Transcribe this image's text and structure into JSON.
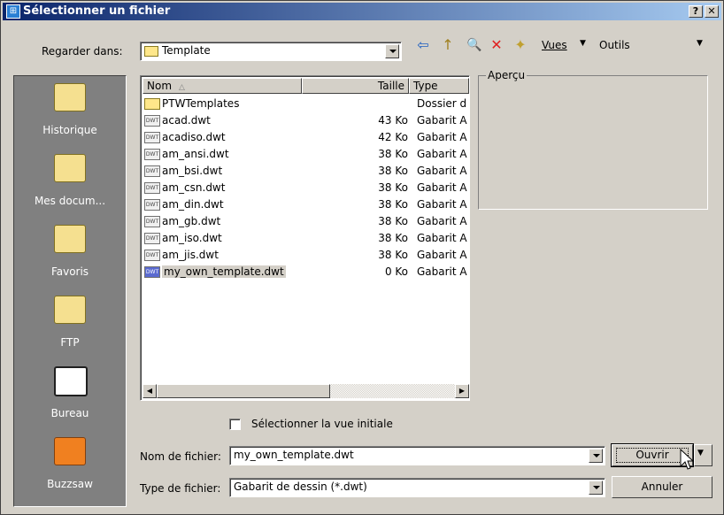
{
  "window": {
    "title": "Sélectionner un fichier",
    "help_label": "?",
    "close_label": "✕",
    "app_icon": "dialog-icon"
  },
  "toolbar": {
    "look_in_label": "Regarder dans:",
    "look_in_value": "Template",
    "back_glyph": "⇦",
    "up_glyph": "↑",
    "search_glyph": "🔍",
    "delete_glyph": "✕",
    "newfolder_glyph": "✦",
    "views_label": "Vues",
    "tools_label": "Outils"
  },
  "places": [
    {
      "label": "Historique",
      "icon": "history-icon"
    },
    {
      "label": "Mes docum...",
      "icon": "my-documents-icon"
    },
    {
      "label": "Favoris",
      "icon": "favorites-icon"
    },
    {
      "label": "FTP",
      "icon": "ftp-icon"
    },
    {
      "label": "Bureau",
      "icon": "desktop-icon"
    },
    {
      "label": "Buzzsaw",
      "icon": "buzzsaw-icon"
    }
  ],
  "columns": {
    "name": "Nom",
    "name_sort": "△",
    "size": "Taille",
    "type": "Type"
  },
  "dwt_badge": "DWT",
  "files": [
    {
      "name": "PTWTemplates",
      "size": "",
      "type": "Dossier d",
      "kind": "folder"
    },
    {
      "name": "acad.dwt",
      "size": "43 Ko",
      "type": "Gabarit A",
      "kind": "dwt"
    },
    {
      "name": "acadiso.dwt",
      "size": "42 Ko",
      "type": "Gabarit A",
      "kind": "dwt"
    },
    {
      "name": "am_ansi.dwt",
      "size": "38 Ko",
      "type": "Gabarit A",
      "kind": "dwt"
    },
    {
      "name": "am_bsi.dwt",
      "size": "38 Ko",
      "type": "Gabarit A",
      "kind": "dwt"
    },
    {
      "name": "am_csn.dwt",
      "size": "38 Ko",
      "type": "Gabarit A",
      "kind": "dwt"
    },
    {
      "name": "am_din.dwt",
      "size": "38 Ko",
      "type": "Gabarit A",
      "kind": "dwt"
    },
    {
      "name": "am_gb.dwt",
      "size": "38 Ko",
      "type": "Gabarit A",
      "kind": "dwt"
    },
    {
      "name": "am_iso.dwt",
      "size": "38 Ko",
      "type": "Gabarit A",
      "kind": "dwt"
    },
    {
      "name": "am_jis.dwt",
      "size": "38 Ko",
      "type": "Gabarit A",
      "kind": "dwt"
    },
    {
      "name": "my_own_template.dwt",
      "size": "0 Ko",
      "type": "Gabarit A",
      "kind": "dwt",
      "selected": true
    }
  ],
  "preview_label": "Aperçu",
  "initial_view_label": "Sélectionner la vue initiale",
  "filename_label": "Nom de fichier:",
  "filename_value": "my_own_template.dwt",
  "filetype_label": "Type de fichier:",
  "filetype_value": "Gabarit de dessin (*.dwt)",
  "open_label": "Ouvrir",
  "cancel_label": "Annuler",
  "colors": {
    "title_start": "#0a246a",
    "title_end": "#a6caf0",
    "face": "#d4d0c8",
    "places_bg": "#808080"
  }
}
